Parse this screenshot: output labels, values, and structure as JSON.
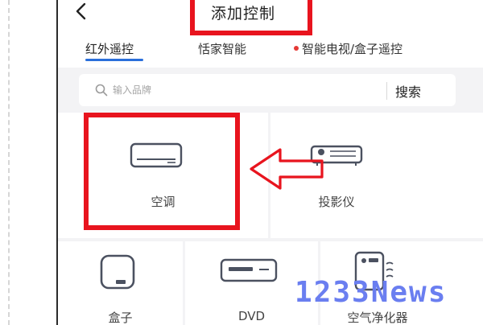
{
  "header": {
    "title": "添加控制"
  },
  "tabs": [
    {
      "label": "红外遥控",
      "active": true
    },
    {
      "label": "恬家智能",
      "active": false
    },
    {
      "label": "智能电视/盒子遥控",
      "active": false,
      "has_dot": true
    }
  ],
  "search": {
    "placeholder": "输入品牌",
    "button_label": "搜索"
  },
  "devices": [
    {
      "label": "空调",
      "icon": "air-conditioner-icon"
    },
    {
      "label": "投影仪",
      "icon": "projector-icon"
    },
    {
      "label": "盒子",
      "icon": "tv-box-icon"
    },
    {
      "label": "DVD",
      "icon": "dvd-player-icon"
    },
    {
      "label": "空气净化器",
      "icon": "air-purifier-icon"
    }
  ],
  "watermark": "1233News",
  "colors": {
    "highlight": "#e8141e",
    "accent": "#2a6fdb",
    "watermark": "#6a7ef0"
  }
}
